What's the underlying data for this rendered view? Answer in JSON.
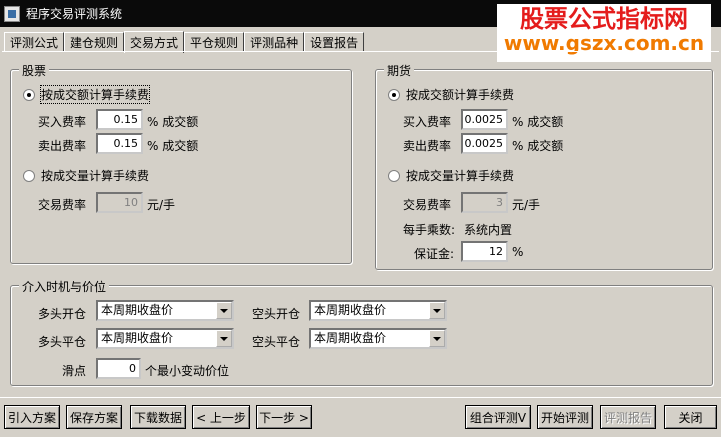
{
  "window": {
    "title": "程序交易评测系统"
  },
  "watermark": {
    "line1": "股票公式指标网",
    "line2": "www.gszx.com.cn"
  },
  "tabs": [
    "评测公式",
    "建仓规则",
    "交易方式",
    "平仓规则",
    "评测品种",
    "设置报告"
  ],
  "active_tab": "交易方式",
  "stock": {
    "legend": "股票",
    "radio_amount": "按成交额计算手续费",
    "buy_label": "买入费率",
    "buy_value": "0.15",
    "buy_unit": "% 成交额",
    "sell_label": "卖出费率",
    "sell_value": "0.15",
    "sell_unit": "% 成交额",
    "radio_volume": "按成交量计算手续费",
    "fee_label": "交易费率",
    "fee_value": "10",
    "fee_unit": "元/手"
  },
  "futures": {
    "legend": "期货",
    "radio_amount": "按成交额计算手续费",
    "buy_label": "买入费率",
    "buy_value": "0.0025",
    "buy_unit": "% 成交额",
    "sell_label": "卖出费率",
    "sell_value": "0.0025",
    "sell_unit": "% 成交额",
    "radio_volume": "按成交量计算手续费",
    "fee_label": "交易费率",
    "fee_value": "3",
    "fee_unit": "元/手",
    "multiplier_label": "每手乘数:",
    "multiplier_value": "系统内置",
    "margin_label": "保证金:",
    "margin_value": "12",
    "margin_unit": "%"
  },
  "entry": {
    "legend": "介入时机与价位",
    "long_open_label": "多头开仓",
    "long_open_value": "本周期收盘价",
    "short_open_label": "空头开仓",
    "short_open_value": "本周期收盘价",
    "long_close_label": "多头平仓",
    "long_close_value": "本周期收盘价",
    "short_close_label": "空头平仓",
    "short_close_value": "本周期收盘价",
    "slippage_label": "滑点",
    "slippage_value": "0",
    "slippage_unit": "个最小变动价位"
  },
  "buttons": {
    "import": "引入方案",
    "save": "保存方案",
    "download": "下载数据",
    "prev": "< 上一步",
    "next": "下一步 >",
    "combo": "组合评测V",
    "start": "开始评测",
    "report": "评测报告",
    "close": "关闭"
  }
}
